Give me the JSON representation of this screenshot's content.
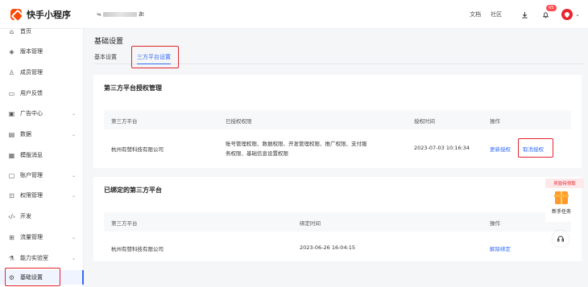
{
  "header": {
    "logo_text": "快手小程序",
    "app_name_prefix": "≒",
    "app_name_suffix": "∄t",
    "links": [
      "文档",
      "社区"
    ],
    "notification_count": "65"
  },
  "sidebar": {
    "items": [
      {
        "label": "首页",
        "icon": "home-icon",
        "has_chevron": false
      },
      {
        "label": "版本管理",
        "icon": "layers-icon",
        "has_chevron": false
      },
      {
        "label": "成员管理",
        "icon": "users-icon",
        "has_chevron": false
      },
      {
        "label": "用户反馈",
        "icon": "feedback-icon",
        "has_chevron": false
      },
      {
        "label": "广告中心",
        "icon": "ad-icon",
        "has_chevron": true
      },
      {
        "label": "数据",
        "icon": "chart-icon",
        "has_chevron": true
      },
      {
        "label": "模版消息",
        "icon": "message-icon",
        "has_chevron": false
      },
      {
        "label": "账户管理",
        "icon": "account-icon",
        "has_chevron": true
      },
      {
        "label": "权限管理",
        "icon": "permission-icon",
        "has_chevron": true
      },
      {
        "label": "开发",
        "icon": "code-icon",
        "has_chevron": false
      },
      {
        "label": "流量管理",
        "icon": "traffic-icon",
        "has_chevron": true
      },
      {
        "label": "能力实验室",
        "icon": "lab-icon",
        "has_chevron": true
      },
      {
        "label": "基础设置",
        "icon": "gear-icon",
        "has_chevron": false,
        "active": true
      }
    ]
  },
  "main": {
    "page_title": "基础设置",
    "tabs": [
      {
        "label": "基本设置",
        "active": false
      },
      {
        "label": "三方平台设置",
        "active": true
      }
    ]
  },
  "auth_section": {
    "title": "第三方平台授权管理",
    "columns": [
      "第三方平台",
      "已授权权限",
      "授权时间",
      "操作"
    ],
    "rows": [
      {
        "platform": "杭州有赞科技有限公司",
        "permissions_line1": "账号管理权限、数据权限、开发管理权限、推广权限、支付服",
        "permissions_line2": "务权限、基础信息设置权限",
        "time": "2023-07-03 10:16:34",
        "action_update": "更新授权",
        "action_cancel": "取消授权"
      }
    ]
  },
  "bound_section": {
    "title": "已绑定的第三方平台",
    "columns": [
      "第三方平台",
      "绑定时间",
      "操作"
    ],
    "rows": [
      {
        "platform": "杭州有赞科技有限公司",
        "time": "2023-06-26 16:04:15",
        "action": "解除绑定"
      }
    ]
  },
  "float_widget": {
    "reward_text": "奖励待领取",
    "task_label": "新手任务"
  },
  "colors": {
    "accent": "#326bfb",
    "highlight_box": "#e0262f",
    "brand": "#ff4906"
  }
}
